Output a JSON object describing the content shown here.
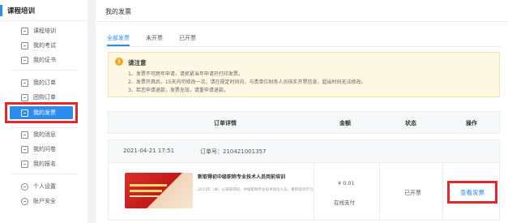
{
  "sidebar": {
    "title": "课程培训",
    "items": [
      {
        "label": "课程培训",
        "icon": "book-icon"
      },
      {
        "label": "我的考试",
        "icon": "exam-icon"
      },
      {
        "label": "我的证书",
        "icon": "certificate-icon"
      },
      {
        "label": "我的订单",
        "icon": "order-icon"
      },
      {
        "label": "团购订单",
        "icon": "group-order-icon"
      },
      {
        "label": "我的发票",
        "icon": "invoice-icon"
      },
      {
        "label": "我的消息",
        "icon": "message-icon"
      },
      {
        "label": "我的问卷",
        "icon": "survey-icon"
      },
      {
        "label": "我的报名",
        "icon": "signup-icon"
      },
      {
        "label": "个人设置",
        "icon": "settings-icon"
      },
      {
        "label": "账户安全",
        "icon": "shield-icon"
      }
    ],
    "active_index": 5
  },
  "main": {
    "title": "我的发票",
    "tabs": [
      {
        "label": "全部发票",
        "active": true
      },
      {
        "label": "未开票",
        "active": false
      },
      {
        "label": "已开票",
        "active": false
      }
    ],
    "notice": {
      "title": "请注意",
      "lines": [
        "1、发票不可跨年申请，请抓紧当年申请开打印发票。",
        "2、发票开具后，15天内可修改一次，请在规定时间内，与贵单位财务人员核实开票信息，超出时间无法修改。",
        "3、若您申请退款，发票无效，请重申请退款。"
      ]
    },
    "table": {
      "headers": [
        "订单详情",
        "金额",
        "状态",
        "操作"
      ]
    },
    "order": {
      "date": "2021-04-21 17:51",
      "order_no": "订单号：210421001357",
      "course_name": "新取得初中级职称专业技术人员岗前培训",
      "course_desc": "2013年（本）以来取得初、中级职称专业技术岗位人员，重新培训学习。",
      "amount": "¥ 0.01",
      "pay_method": "在线支付",
      "status": "已开票",
      "action": "查看发票"
    }
  },
  "colors": {
    "accent": "#2d8cf0",
    "highlight": "#e5262b",
    "notice_bg": "#fdf8e4"
  }
}
